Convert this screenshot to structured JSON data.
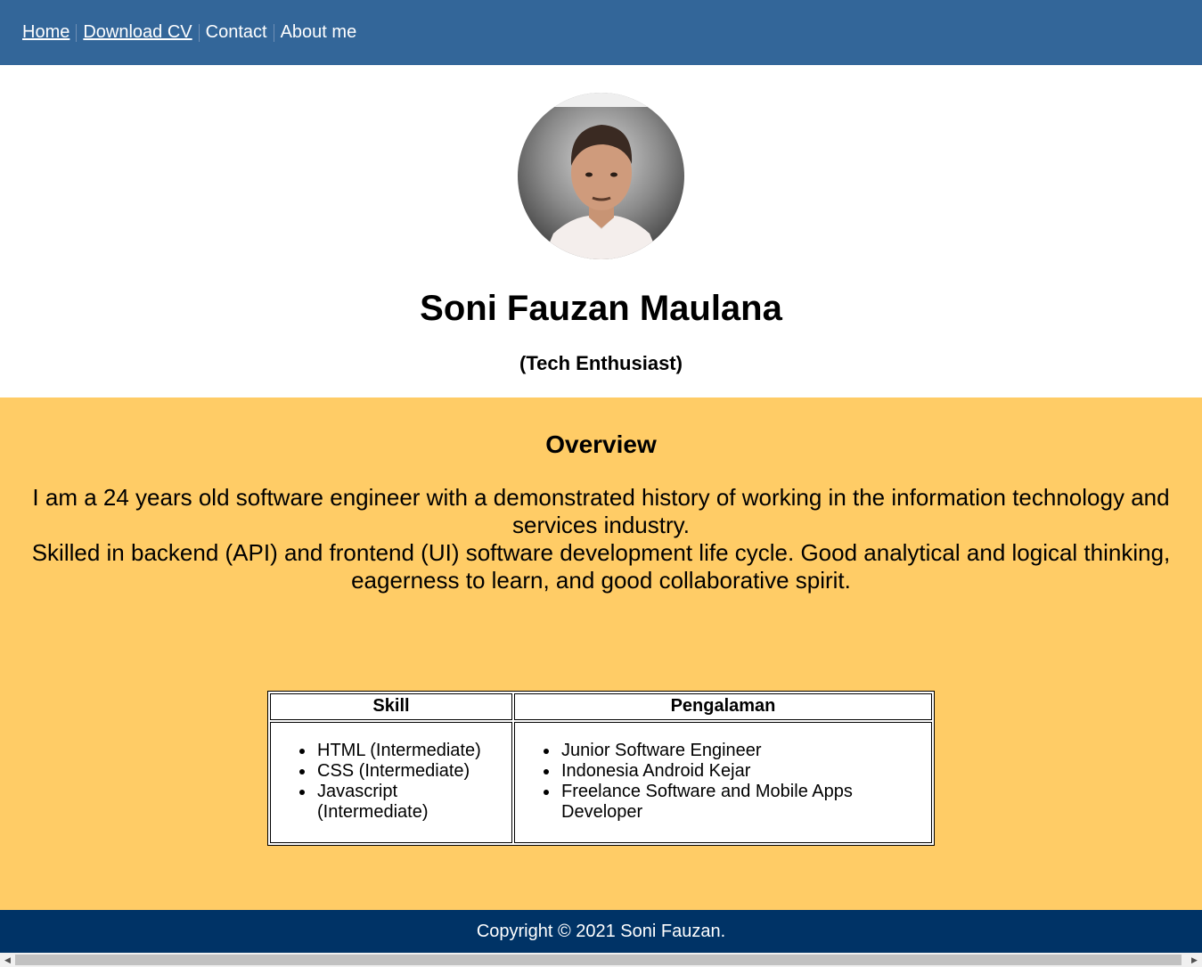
{
  "nav": {
    "items": [
      {
        "label": "Home"
      },
      {
        "label": "Download CV"
      },
      {
        "label": "Contact"
      },
      {
        "label": "About me"
      }
    ]
  },
  "profile": {
    "name": "Soni Fauzan Maulana",
    "role": "(Tech Enthusiast)",
    "avatar_icon": "profile-photo"
  },
  "overview": {
    "title": "Overview",
    "paragraph1": "I am a 24 years old software engineer with a demonstrated history of working in the information technology and services industry.",
    "paragraph2": "Skilled in backend (API) and frontend (UI) software development life cycle. Good analytical and logical thinking, eagerness to learn, and good collaborative spirit."
  },
  "table": {
    "headers": [
      "Skill",
      "Pengalaman"
    ],
    "skills": [
      "HTML (Intermediate)",
      "CSS (Intermediate)",
      "Javascript (Intermediate)"
    ],
    "experience": [
      "Junior Software Engineer",
      "Indonesia Android Kejar",
      "Freelance Software and Mobile Apps Developer"
    ]
  },
  "footer": {
    "copyright": "Copyright © 2021 Soni Fauzan."
  },
  "colors": {
    "nav_bg": "#336699",
    "overview_bg": "#ffcc66",
    "footer_bg": "#003366"
  }
}
